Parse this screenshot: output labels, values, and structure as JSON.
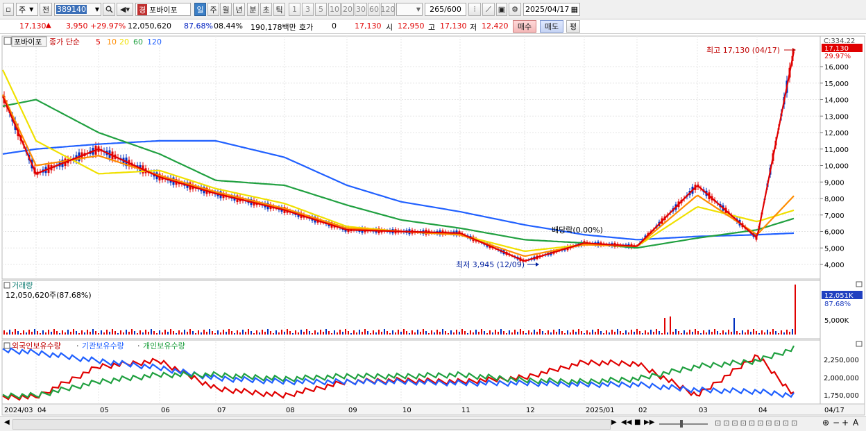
{
  "toolbar": {
    "market_type": "주",
    "prefix": "전",
    "code": "389140",
    "badge": "경",
    "name": "포바이포",
    "periods": [
      "일",
      "주",
      "월",
      "년",
      "분",
      "초",
      "틱"
    ],
    "active_period": "일",
    "minutes": [
      "1",
      "3",
      "5",
      "10",
      "20",
      "30",
      "60",
      "120"
    ],
    "count": "265",
    "count_max": "/600",
    "date": "2025/04/17"
  },
  "ticker": {
    "price": "17,130",
    "change": "3,950",
    "change_pct": "+29.97%",
    "volume": "12,050,620",
    "vol_ratio": "87.68%",
    "turnover": "08.44%",
    "amount": "190,178백만",
    "quote_label": "호가",
    "quote_val": "0",
    "quote_price": "17,130",
    "open_label": "시",
    "open": "12,950",
    "high_label": "고",
    "high": "17,130",
    "low_label": "저",
    "low": "12,420",
    "buy": "매수",
    "sell": "매도",
    "misc": "평"
  },
  "legend": {
    "name": "포바이포",
    "ma_label": "종가 단순",
    "ma_periods": [
      "5",
      "10",
      "20",
      "60",
      "120"
    ],
    "ma_colors": [
      "#e00000",
      "#ff8c00",
      "#f0e000",
      "#20a040",
      "#2060ff"
    ]
  },
  "annotations": {
    "high": "최고 17,130 (04/17)",
    "low": "최저 3,945 (12/09)",
    "dividend": "배당락(0.00%)"
  },
  "volume_panel": {
    "title": "거래량",
    "value": "12,050,620주(87.68%)",
    "last": "12,051K",
    "ratio": "87.68%",
    "tick": "5,000K"
  },
  "holdings_panel": {
    "series": [
      "외국인보유수량",
      "기관보유수량",
      "개인보유수량"
    ],
    "ticks": [
      "2,250,000",
      "2,000,000",
      "1,750,000"
    ]
  },
  "price_axis": {
    "ticks": [
      "16,000",
      "15,000",
      "14,000",
      "13,000",
      "12,000",
      "11,000",
      "10,000",
      "9,000",
      "8,000",
      "7,000",
      "6,000",
      "5,000",
      "4,000"
    ],
    "top_label": "C:334.22",
    "current": "17,130",
    "current_pct": "29.97%"
  },
  "x_axis": {
    "labels": [
      "2024/03",
      "04",
      "05",
      "06",
      "07",
      "08",
      "09",
      "10",
      "11",
      "12",
      "2025/01",
      "02",
      "03",
      "04"
    ],
    "end_label": "04/17"
  },
  "chart_data": {
    "type": "line",
    "x_range": [
      "2024/03",
      "2025/04/17"
    ],
    "ylim": [
      3500,
      17500
    ],
    "series": [
      {
        "name": "5",
        "color": "#e00000",
        "x": [
          "2024/03",
          "2024/04",
          "2024/05",
          "2024/06",
          "2024/07",
          "2024/08",
          "2024/09",
          "2024/10",
          "2024/11",
          "2024/12",
          "2025/01",
          "2025/02",
          "2025/03",
          "2025/04",
          "2025/04/17"
        ],
        "values": [
          14200,
          9500,
          11000,
          9300,
          8300,
          7300,
          6100,
          6000,
          5900,
          4200,
          5300,
          5100,
          8800,
          5600,
          17130
        ]
      },
      {
        "name": "10",
        "color": "#ff8c00",
        "x": [
          "2024/03",
          "2024/04",
          "2024/05",
          "2024/06",
          "2024/07",
          "2024/08",
          "2024/09",
          "2024/10",
          "2024/11",
          "2024/12",
          "2025/01",
          "2025/02",
          "2025/03",
          "2025/04",
          "2025/04/17"
        ],
        "values": [
          14300,
          10000,
          10600,
          9400,
          8400,
          7400,
          6200,
          6000,
          5800,
          4500,
          5200,
          5100,
          8200,
          5800,
          8200
        ]
      },
      {
        "name": "20",
        "color": "#f0e000",
        "x": [
          "2024/03",
          "2024/04",
          "2024/05",
          "2024/06",
          "2024/07",
          "2024/08",
          "2024/09",
          "2024/10",
          "2024/11",
          "2024/12",
          "2025/01",
          "2025/02",
          "2025/03",
          "2025/04",
          "2025/04/17"
        ],
        "values": [
          15800,
          11500,
          9500,
          9700,
          8600,
          7700,
          6300,
          6000,
          5800,
          4800,
          5200,
          5100,
          7500,
          6600,
          7300
        ]
      },
      {
        "name": "60",
        "color": "#20a040",
        "x": [
          "2024/03",
          "2024/04",
          "2024/05",
          "2024/06",
          "2024/07",
          "2024/08",
          "2024/09",
          "2024/10",
          "2024/11",
          "2024/12",
          "2025/01",
          "2025/02",
          "2025/03",
          "2025/04",
          "2025/04/17"
        ],
        "values": [
          13600,
          14000,
          12000,
          10700,
          9100,
          8800,
          7600,
          6700,
          6200,
          5500,
          5300,
          5000,
          5600,
          6100,
          6800
        ]
      },
      {
        "name": "120",
        "color": "#2060ff",
        "x": [
          "2024/03",
          "2024/04",
          "2024/05",
          "2024/06",
          "2024/07",
          "2024/08",
          "2024/09",
          "2024/10",
          "2024/11",
          "2024/12",
          "2025/01",
          "2025/02",
          "2025/03",
          "2025/04",
          "2025/04/17"
        ],
        "values": [
          10700,
          11000,
          11300,
          11500,
          11500,
          10500,
          8800,
          7800,
          7200,
          6400,
          5800,
          5500,
          5700,
          5800,
          5900
        ]
      }
    ]
  }
}
